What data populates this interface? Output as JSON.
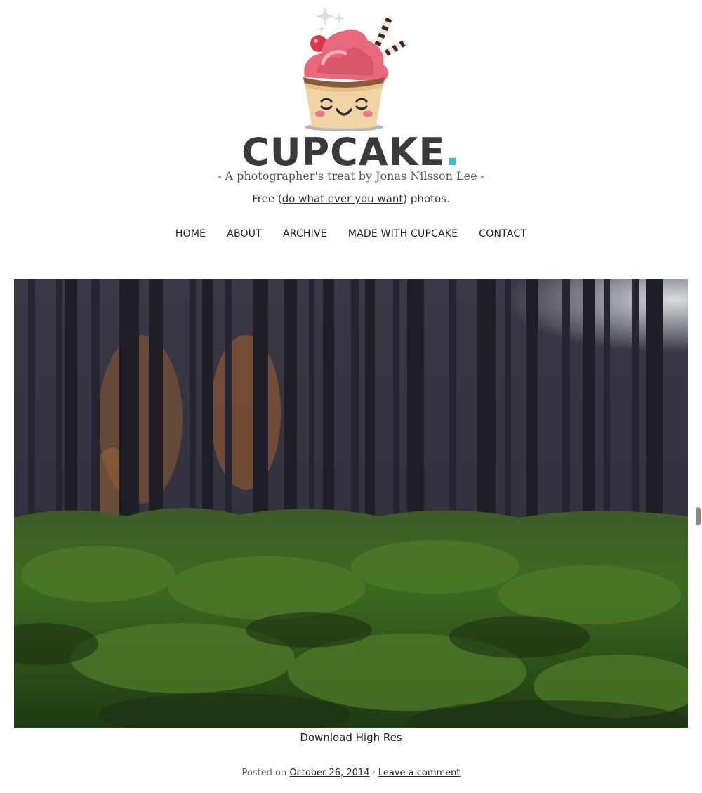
{
  "site": {
    "name": "CUPCAKE",
    "name_dot": ".",
    "tagline": "- A photographer's treat by Jonas Nilsson Lee -",
    "free_prefix": "Free (",
    "free_link": "do what ever you want",
    "free_suffix": ") photos.",
    "accent_color": "#3dbcc3"
  },
  "nav": {
    "items": [
      {
        "label": "HOME"
      },
      {
        "label": "ABOUT"
      },
      {
        "label": "ARCHIVE"
      },
      {
        "label": "MADE WITH CUPCAKE"
      },
      {
        "label": "CONTACT"
      }
    ]
  },
  "post": {
    "download_label": "Download High Res",
    "posted_on_label": "Posted on",
    "date": "October 26, 2014",
    "separator": "·",
    "comment_label": "Leave a comment"
  }
}
